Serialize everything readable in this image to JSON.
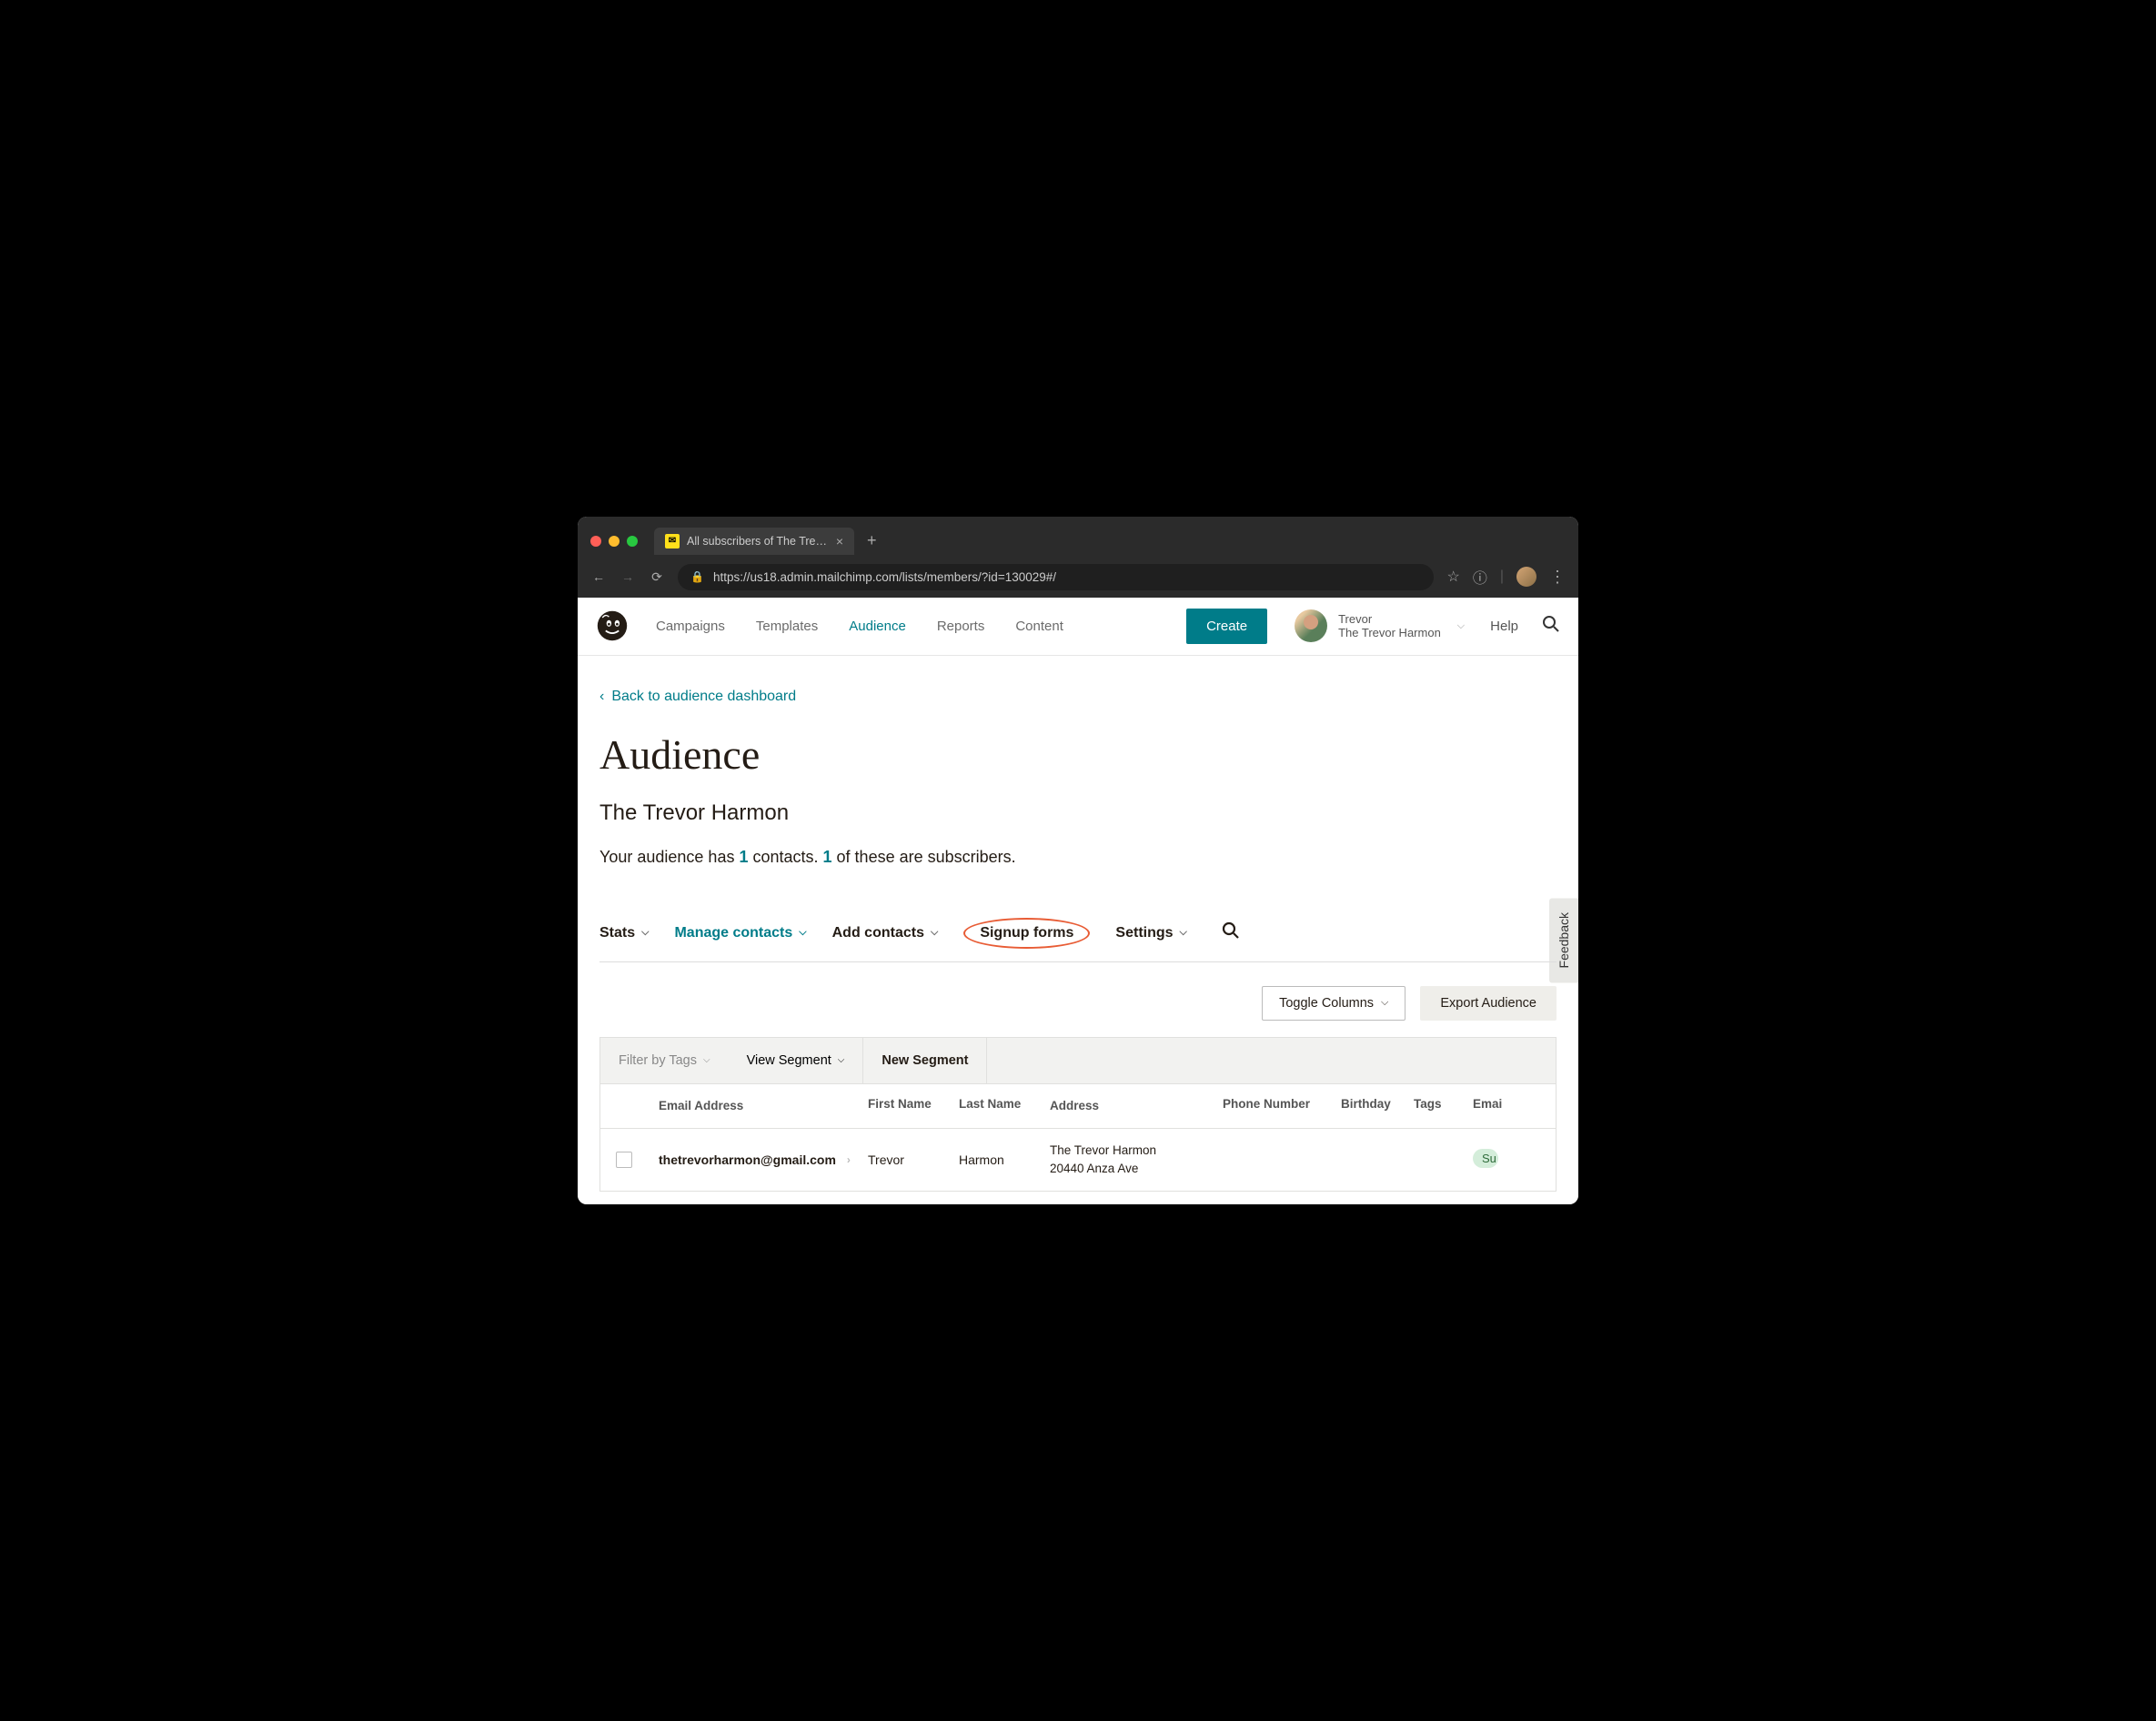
{
  "browser": {
    "tab_title": "All subscribers of The Trevor H",
    "url": "https://us18.admin.mailchimp.com/lists/members/?id=130029#/"
  },
  "nav": {
    "campaigns": "Campaigns",
    "templates": "Templates",
    "audience": "Audience",
    "reports": "Reports",
    "content": "Content",
    "create": "Create",
    "help": "Help"
  },
  "user": {
    "name": "Trevor",
    "org": "The Trevor Harmon"
  },
  "page": {
    "back_link": "Back to audience dashboard",
    "title": "Audience",
    "subtitle": "The Trevor Harmon",
    "desc_prefix": "Your audience has ",
    "desc_count1": "1",
    "desc_mid": " contacts. ",
    "desc_count2": "1",
    "desc_suffix": " of these are subscribers."
  },
  "tabs": {
    "stats": "Stats",
    "manage": "Manage contacts",
    "add": "Add contacts",
    "signup": "Signup forms",
    "settings": "Settings"
  },
  "actions": {
    "toggle": "Toggle Columns",
    "export": "Export Audience"
  },
  "filters": {
    "tags": "Filter by Tags",
    "view_segment": "View Segment",
    "new_segment": "New Segment"
  },
  "table": {
    "headers": {
      "email": "Email Address",
      "fname": "First Name",
      "lname": "Last Name",
      "address": "Address",
      "phone": "Phone Number",
      "birthday": "Birthday",
      "tags": "Tags",
      "email_marketing": "Emai"
    },
    "rows": [
      {
        "email": "thetrevorharmon@gmail.com",
        "fname": "Trevor",
        "lname": "Harmon",
        "address_line1": "The Trevor Harmon",
        "address_line2": "20440 Anza Ave",
        "status": "Su"
      }
    ]
  },
  "feedback": "Feedback"
}
